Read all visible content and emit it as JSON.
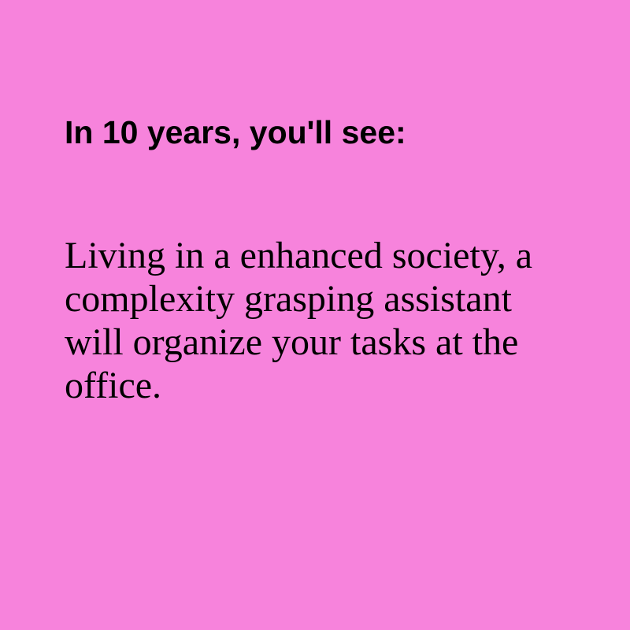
{
  "theme": {
    "background_color": "#f783dc",
    "text_color": "#000000"
  },
  "card": {
    "headline": "In 10 years, you'll see:",
    "body": "Living in a enhanced society, a complexity grasping assistant will organize your tasks at the office."
  }
}
